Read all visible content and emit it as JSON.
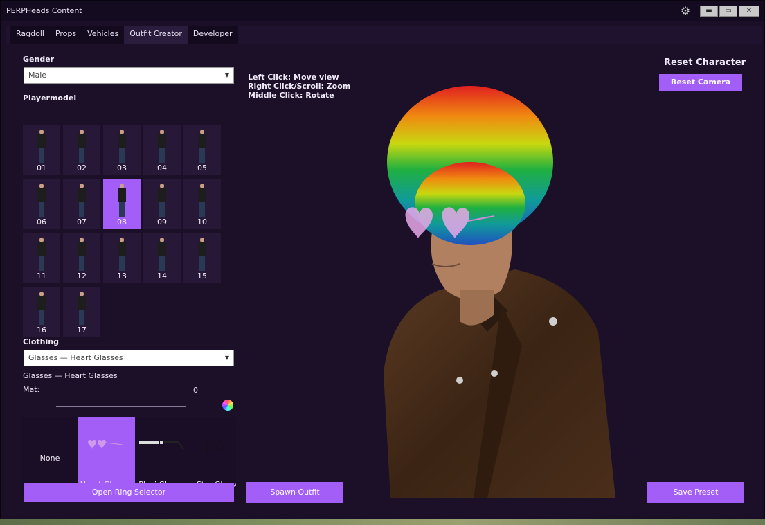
{
  "window": {
    "title": "PERPHeads Content"
  },
  "tabs": [
    {
      "label": "Ragdoll"
    },
    {
      "label": "Props"
    },
    {
      "label": "Vehicles"
    },
    {
      "label": "Outfit Creator",
      "active": true
    },
    {
      "label": "Developer"
    }
  ],
  "gender": {
    "label": "Gender",
    "value": "Male"
  },
  "playermodel": {
    "label": "Playermodel",
    "selected": "08",
    "models": [
      "01",
      "02",
      "03",
      "04",
      "05",
      "06",
      "07",
      "08",
      "09",
      "10",
      "11",
      "12",
      "13",
      "14",
      "15",
      "16",
      "17"
    ]
  },
  "clothing": {
    "label": "Clothing",
    "value": "Glasses — Heart Glasses",
    "current": "Glasses — Heart Glasses",
    "mat_label": "Mat:",
    "mat_value": "0",
    "items": [
      {
        "label": "None"
      },
      {
        "label": "Heart Glasses",
        "selected": true
      },
      {
        "label": "Plexi Glasses"
      },
      {
        "label": "Star Glasses"
      }
    ]
  },
  "help": {
    "line1": "Left Click: Move view",
    "line2": "Right Click/Scroll: Zoom",
    "line3": "Middle Click: Rotate"
  },
  "buttons": {
    "reset_character": "Reset Character",
    "reset_camera": "Reset Camera",
    "open_ring": "Open Ring Selector",
    "spawn_outfit": "Spawn Outfit",
    "save_preset": "Save Preset"
  },
  "colors": {
    "accent": "#a35ef7",
    "panel": "#1c1029",
    "titlebar": "#150b20"
  },
  "icons": [
    "gear-icon",
    "minimize-icon",
    "maximize-icon",
    "close-icon",
    "chevron-down-icon",
    "color-wheel-icon",
    "arrow-right-icon"
  ]
}
